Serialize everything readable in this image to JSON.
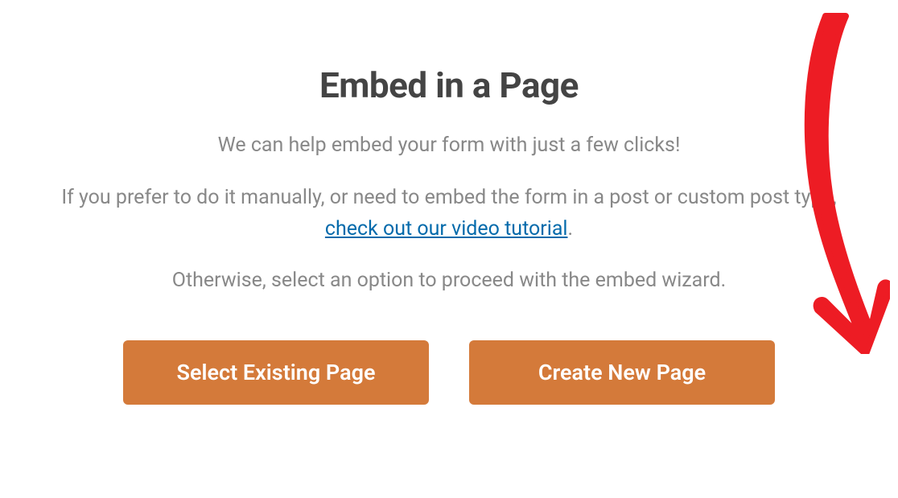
{
  "modal": {
    "title": "Embed in a Page",
    "description_line1": "We can help embed your form with just a few clicks!",
    "description_line2_prefix": "If you prefer to do it manually, or need to embed the form in a post or custom post type, ",
    "description_line2_link": "check out our video tutorial",
    "description_line2_suffix": ".",
    "description_line3": "Otherwise, select an option to proceed with the embed wizard.",
    "buttons": {
      "select_existing": "Select Existing Page",
      "create_new": "Create New Page"
    }
  },
  "colors": {
    "button_bg": "#D47A3A",
    "link": "#036AAB",
    "title": "#444444",
    "body_text": "#888888",
    "annotation": "#ED1C24"
  }
}
